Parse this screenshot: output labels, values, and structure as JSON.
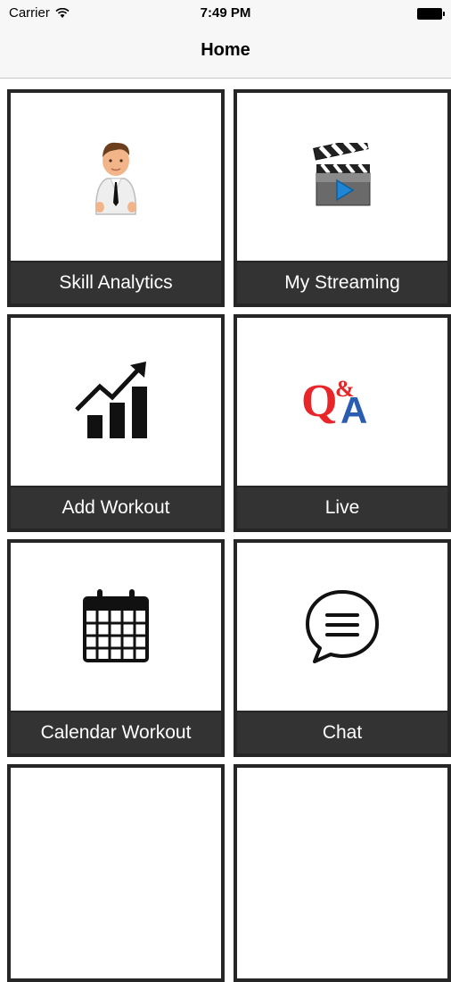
{
  "status_bar": {
    "carrier": "Carrier",
    "time": "7:49 PM"
  },
  "nav": {
    "title": "Home"
  },
  "tiles": [
    {
      "label": "Skill Analytics",
      "icon": "person-icon"
    },
    {
      "label": "My Streaming",
      "icon": "clapperboard-play-icon"
    },
    {
      "label": "Add Workout",
      "icon": "bar-chart-trend-icon"
    },
    {
      "label": "Live",
      "icon": "q-and-a-icon"
    },
    {
      "label": "Calendar Workout",
      "icon": "calendar-icon"
    },
    {
      "label": "Chat",
      "icon": "chat-bubble-icon"
    }
  ],
  "colors": {
    "tile_border": "#262626",
    "label_bg": "#333333",
    "label_text": "#ffffff",
    "q_red": "#e8262a",
    "a_blue": "#2a5db0"
  }
}
